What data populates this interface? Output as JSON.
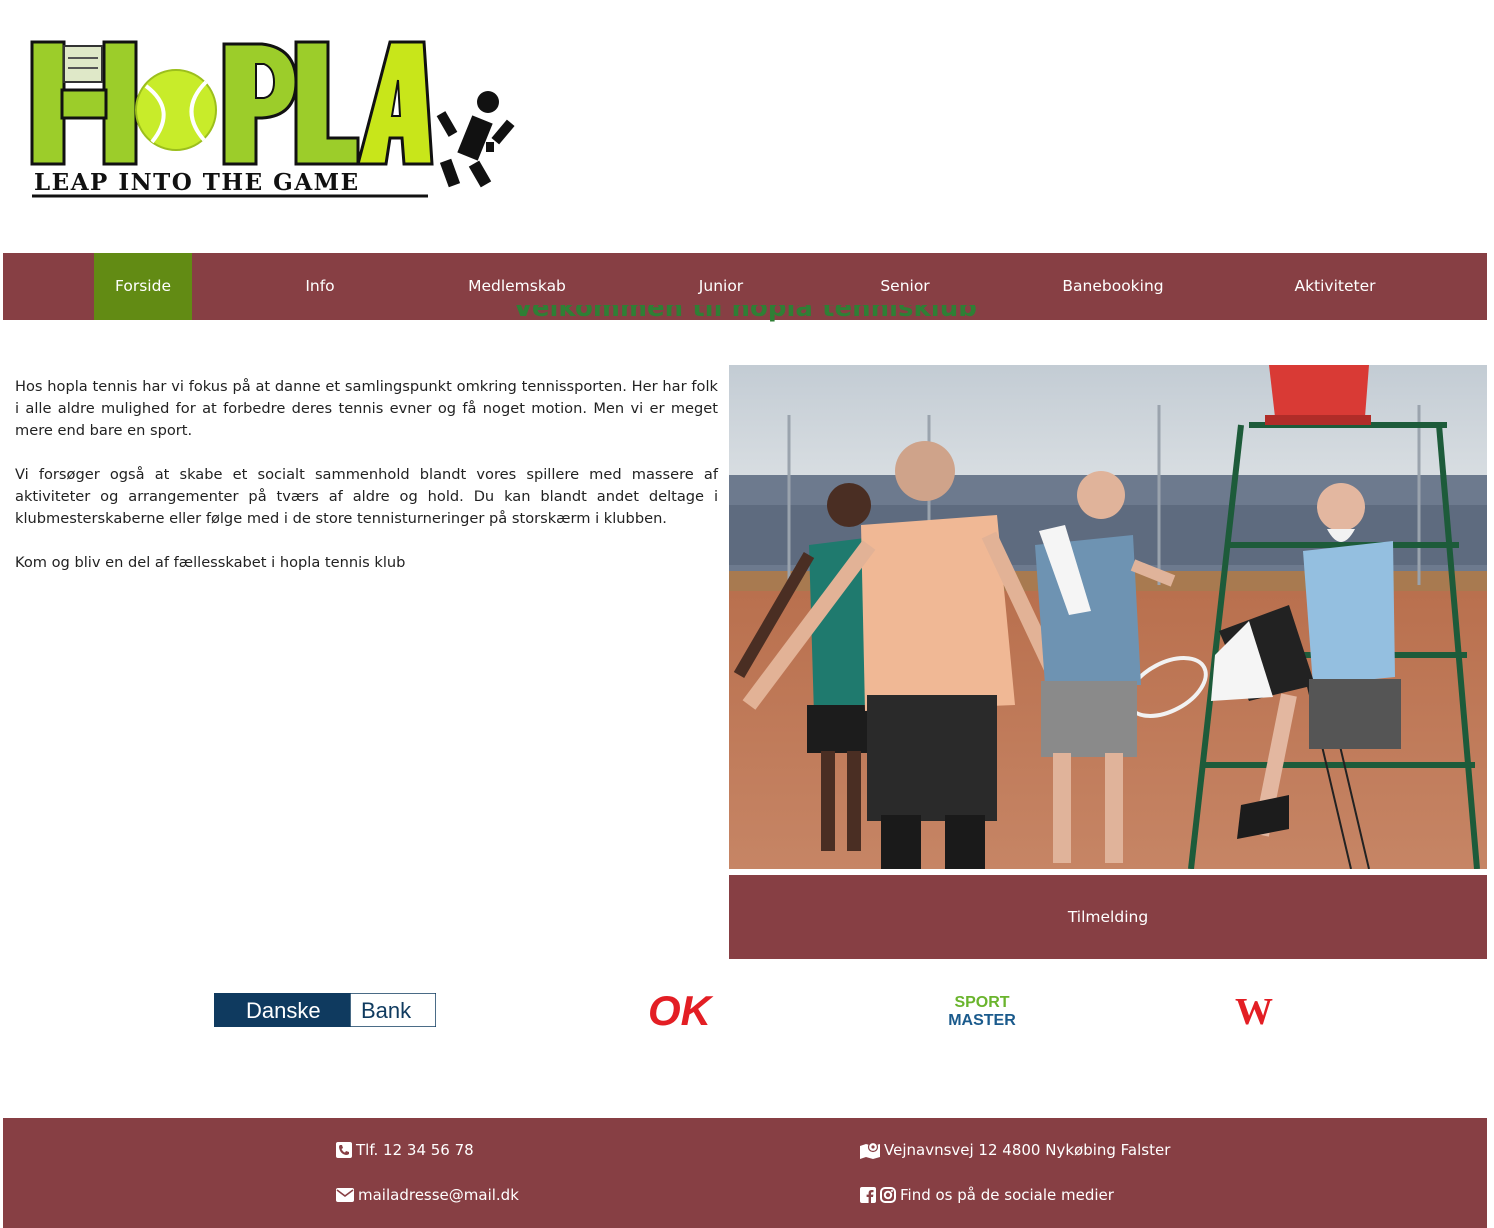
{
  "header": {
    "logo_text": "HOPLA",
    "logo_tagline": "LEAP INTO THE GAME"
  },
  "nav": {
    "items": [
      {
        "label": "Forside",
        "active": true
      },
      {
        "label": "Info"
      },
      {
        "label": "Medlemskab"
      },
      {
        "label": "Junior"
      },
      {
        "label": "Senior"
      },
      {
        "label": "Banebooking"
      },
      {
        "label": "Aktiviteter"
      }
    ]
  },
  "main": {
    "heading": "Velkommen til hopla tennisklub",
    "paragraphs": [
      "Hos hopla tennis har vi fokus på at danne et samlingspunkt omkring tennissporten. Her har folk i alle aldre mulighed for at forbedre deres tennis evner og få noget motion. Men vi er meget mere end bare en sport.",
      "Vi forsøger også at skabe et socialt sammenhold blandt vores spillere med massere af aktiviteter og arrangementer på tværs af aldre og hold. Du kan blandt andet deltage i klubmesterskaberne eller følge med i de store tennisturneringer på storskærm i klubben.",
      "Kom og bliv en del af fællesskabet i hopla tennis klub"
    ],
    "signup_label": "Tilmelding"
  },
  "sponsors": {
    "danske": [
      "Danske",
      "Bank"
    ],
    "ok": "OK",
    "sportmaster": [
      "SPORT",
      "MASTER"
    ],
    "wilson": "W"
  },
  "footer": {
    "phone": "Tlf. 12 34 56 78",
    "email": "mailadresse@mail.dk",
    "address": "Vejnavnsvej 12 4800 Nykøbing Falster",
    "social": "Find os på de sociale medier"
  },
  "colors": {
    "nav_bg": "#873f44",
    "nav_active": "#628b14",
    "footer_bg": "#873f44",
    "logo_green": "#9ccd2a"
  }
}
